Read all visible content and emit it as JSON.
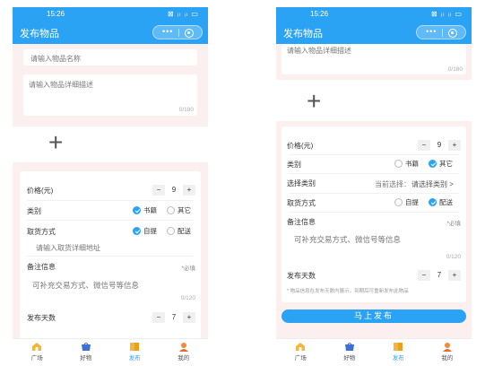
{
  "colors": {
    "primary": "#2ba3f5",
    "pink_bg": "#fbeff0"
  },
  "status": {
    "time": "15:26",
    "icons": "⊠ ᵢₗ ᵢₗ ▭"
  },
  "navbar": {
    "title": "发布物品",
    "capsule_dots": "•••"
  },
  "left": {
    "name_placeholder": "请输入物品名称",
    "desc_placeholder": "请输入物品详细描述",
    "desc_count": "0/180",
    "price_label": "价格(元)",
    "price_value": "9",
    "category_label": "类别",
    "category_options": [
      "书籍",
      "其它"
    ],
    "pickup_label": "取货方式",
    "pickup_options": [
      "自提",
      "配送"
    ],
    "address_placeholder": "请输入取货详细地址",
    "note_label": "备注信息",
    "note_required": "*必填",
    "note_placeholder": "可补充交易方式、微信号等信息",
    "note_count": "0/120",
    "days_label": "发布天数",
    "days_value": "7"
  },
  "right": {
    "desc_placeholder": "请输入物品详细描述",
    "desc_count": "0/180",
    "price_label": "价格(元)",
    "price_value": "9",
    "category_label": "类别",
    "category_options": [
      "书籍",
      "其它"
    ],
    "select_label": "选择类别",
    "select_current": "当前选择：",
    "select_prompt": "请选择类别 >",
    "pickup_label": "取货方式",
    "pickup_options": [
      "自提",
      "配送"
    ],
    "note_label": "备注信息",
    "note_required": "*必填",
    "note_placeholder": "可补充交易方式、微信号等信息",
    "note_count": "0/120",
    "days_label": "发布天数",
    "days_value": "7",
    "notice": "* 物品信息在发布天数内展示，到期后可重新发布此物品",
    "submit_label": "马上发布"
  },
  "stepper": {
    "minus": "−",
    "plus": "+"
  },
  "plus_sign": "+",
  "tabs": [
    {
      "label": "广场",
      "icon": "home-icon"
    },
    {
      "label": "好物",
      "icon": "shop-icon"
    },
    {
      "label": "发布",
      "icon": "book-icon"
    },
    {
      "label": "我的",
      "icon": "profile-icon"
    }
  ]
}
